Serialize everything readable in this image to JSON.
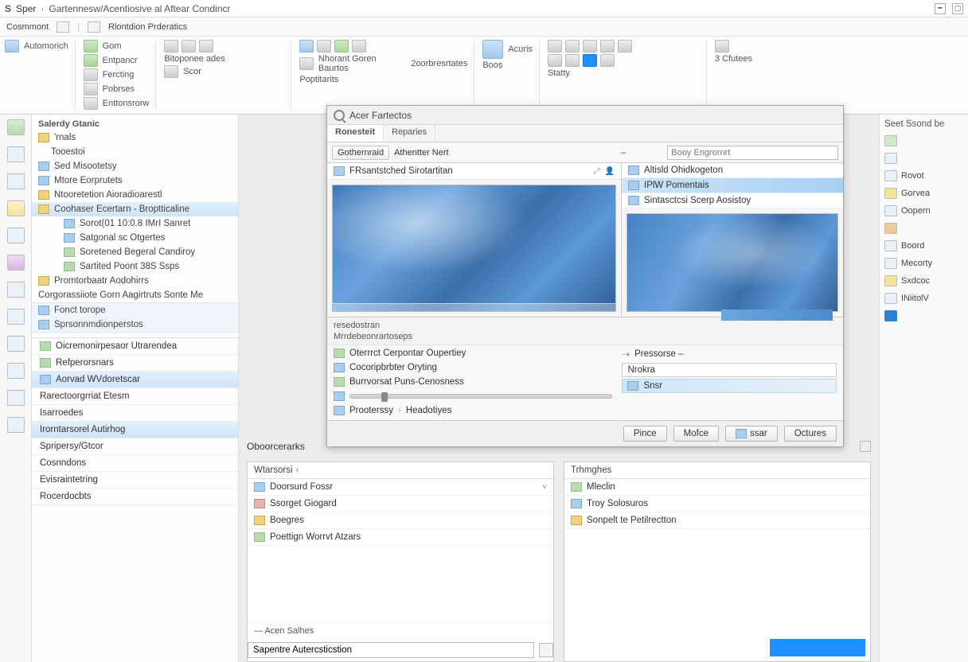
{
  "titlebar": {
    "logo": "S",
    "app": "Sper",
    "title": "Gartennesw/Acentiosive al Aftear Condincr"
  },
  "menubar": {
    "left": "Cosmmont",
    "doc": "Rlontdion Prderatics"
  },
  "ribbon": {
    "group1": {
      "a": "Automorich"
    },
    "group2": {
      "a": "Gom",
      "b": "Entpancr",
      "c": "Fercting",
      "d": "Pobrses",
      "e": "Enttonsrorw"
    },
    "group3": {
      "a": "Bitoponee ades",
      "b": "Scor"
    },
    "group4": {
      "a": "Nhorant Goren Baurtos",
      "b": "2oorbresrtates",
      "c": "Poptitarits"
    },
    "group5": {
      "a": "Acuris",
      "b": "Boos"
    },
    "group6": {
      "a": "Statty"
    },
    "group7": {
      "a": "3 Cfutees"
    }
  },
  "leftnav": {
    "head1": "Salerdy Gtanic",
    "sec1": {
      "a": "'rnals",
      "b": "Tooestoi"
    },
    "items": [
      "Sed Misootetsy",
      "Mtore Eorprutets",
      "Ntooretetion Aioradioarestl",
      "Coohaser Ecertarn - Broptticaline",
      "Sorot(01 10:0.8 IMrI Sanret",
      "Satgonal sc Otgertes",
      "Soretened Begeral Candiroy",
      "Sartited Poont 38S Ssps",
      "Promtorbaatr Aodohirrs",
      "Corgorassiiote Gorn Aagirtruts Sonte Me"
    ],
    "block": {
      "a": "Fonct torope",
      "b": "Sprsonnmdionperstos"
    },
    "lower": [
      "Oicremonirpesaor Utrarendea",
      "Refperorsnars",
      "Aorvad WVdoretscar",
      "Rarectoorgrriat Etesm",
      "Isarroedes",
      "Irorntarsorel Autirhog",
      "Spripersy/Gtcor",
      "Cosnndons",
      "Evisraintetring",
      "Rocerdocbts"
    ]
  },
  "dialog": {
    "title": "Acer Fartectos",
    "tabs": {
      "a": "Ronesteit",
      "b": "Reparies"
    },
    "toolbar": {
      "btn": "Gothernraid",
      "field_label": "Athentter Nert",
      "dash": "–",
      "search_label": "Booy Engrornrt"
    },
    "leftrow": "FRsantstched Sirotartitan",
    "rightlist": {
      "a": "Altisld Ohidkogeton",
      "b": "IPlW Pomentais",
      "c": "Sintasctcsi Scerp Aosistoy"
    },
    "footer1": {
      "a": "resedostran",
      "b": "Mrrdebeonrartoseps"
    },
    "opts": {
      "a": "Oterrrct Cerpontar Oupertiey",
      "b": "Cocoripbrbter Oryting",
      "c": "Burrvorsat Puns-Cenosness"
    },
    "sliderrow": {
      "a": "Prooterssy",
      "b": "Headotiyes"
    },
    "rightdrop": {
      "a": "Pressorse –",
      "b": "Nrokra",
      "c": "Snsr"
    },
    "buttons": {
      "a": "Pince",
      "b": "Mofce",
      "c": "ssar",
      "d": "Octures"
    }
  },
  "lowerpanels": {
    "title": "Oboorcerarks",
    "leftHead": "Wtarsorsi",
    "rightHead": "Trhmghes",
    "left": [
      "Doorsurd Fossr",
      "Ssorget Giogard",
      "Boegres",
      "Poettign Worrvt Atzars"
    ],
    "right": [
      "Mleclin",
      "Troy Solosuros",
      "Sonpelt te Petilrectton"
    ],
    "foot": "Acen Salhes",
    "input_ph": "Sapentre Autercsticstion"
  },
  "rightbar": {
    "head": "Seet Ssond be",
    "items": [
      "Rovot",
      "Gorvea",
      "Oopern",
      "Boord",
      "Mecorty",
      "Sxdcoc",
      "INiitolV"
    ]
  }
}
